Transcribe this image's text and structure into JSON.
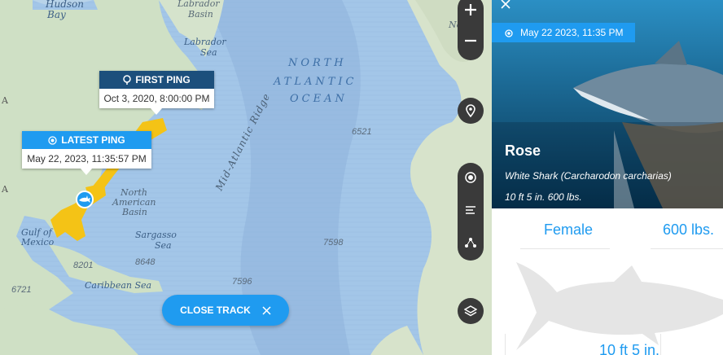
{
  "map": {
    "place_labels": {
      "hudson_bay_1": "Hudson",
      "hudson_bay_2": "Bay",
      "labrador_basin_1": "Labrador",
      "labrador_basin_2": "Basin",
      "labrador_sea_1": "Labrador",
      "labrador_sea_2": "Sea",
      "north_edge": "North",
      "north_american_basin_1": "North",
      "north_american_basin_2": "American",
      "north_american_basin_3": "Basin",
      "gulf_of_mexico_1": "Gulf of",
      "gulf_of_mexico_2": "Mexico",
      "sargasso_sea_1": "Sargasso",
      "sargasso_sea_2": "Sea",
      "caribbean_sea": "Caribbean Sea",
      "mid_atlantic_ridge": "Mid-Atlantic Ridge",
      "ocean_line_1": "NORTH",
      "ocean_line_2": "ATLANTIC",
      "ocean_line_3": "OCEAN",
      "edge_a_1": "A",
      "edge_a_2": "A"
    },
    "depths": [
      "6521",
      "7598",
      "7596",
      "8201",
      "8648",
      "6721"
    ],
    "first_ping": {
      "title": "FIRST PING",
      "date": "Oct 3, 2020, 8:00:00 PM"
    },
    "latest_ping": {
      "title": "LATEST PING",
      "date": "May 22, 2023, 11:35:57 PM"
    },
    "close_track_label": "CLOSE TRACK"
  },
  "panel": {
    "ping_date": "May 22 2023, 11:35 PM",
    "name": "Rose",
    "species": "White Shark (Carcharodon carcharias)",
    "size_line": "10 ft 5 in. 600 lbs.",
    "gender": "Female",
    "weight": "600 lbs.",
    "length": "10 ft 5 in."
  },
  "colors": {
    "accent": "#1f9bf0",
    "first_ping_header": "#1c4f7c",
    "track": "#f4c316",
    "control_bg": "#3a3a3a"
  },
  "icons": {
    "zoom_in": "plus-icon",
    "zoom_out": "minus-icon",
    "locate": "map-pin-icon",
    "ping": "target-icon",
    "list": "list-icon",
    "share": "nodes-icon",
    "layers": "layers-icon",
    "close": "close-icon"
  }
}
